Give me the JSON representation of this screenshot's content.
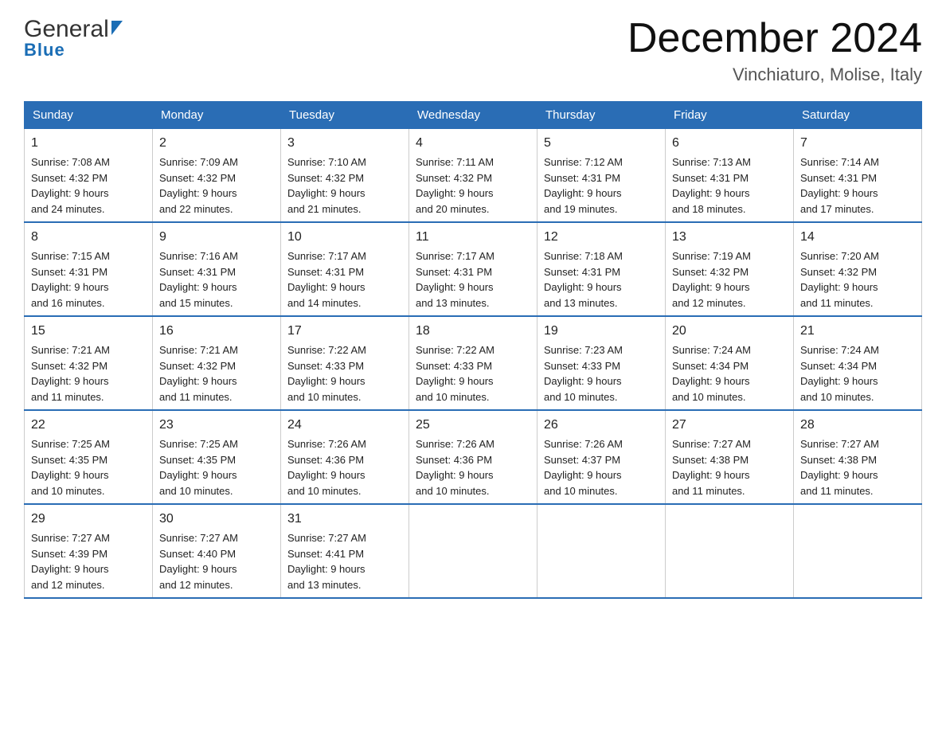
{
  "logo": {
    "general_text": "General",
    "blue_text": "Blue"
  },
  "title": "December 2024",
  "subtitle": "Vinchiaturo, Molise, Italy",
  "weekdays": [
    "Sunday",
    "Monday",
    "Tuesday",
    "Wednesday",
    "Thursday",
    "Friday",
    "Saturday"
  ],
  "weeks": [
    [
      {
        "day": "1",
        "sunrise": "7:08 AM",
        "sunset": "4:32 PM",
        "daylight": "9 hours and 24 minutes."
      },
      {
        "day": "2",
        "sunrise": "7:09 AM",
        "sunset": "4:32 PM",
        "daylight": "9 hours and 22 minutes."
      },
      {
        "day": "3",
        "sunrise": "7:10 AM",
        "sunset": "4:32 PM",
        "daylight": "9 hours and 21 minutes."
      },
      {
        "day": "4",
        "sunrise": "7:11 AM",
        "sunset": "4:32 PM",
        "daylight": "9 hours and 20 minutes."
      },
      {
        "day": "5",
        "sunrise": "7:12 AM",
        "sunset": "4:31 PM",
        "daylight": "9 hours and 19 minutes."
      },
      {
        "day": "6",
        "sunrise": "7:13 AM",
        "sunset": "4:31 PM",
        "daylight": "9 hours and 18 minutes."
      },
      {
        "day": "7",
        "sunrise": "7:14 AM",
        "sunset": "4:31 PM",
        "daylight": "9 hours and 17 minutes."
      }
    ],
    [
      {
        "day": "8",
        "sunrise": "7:15 AM",
        "sunset": "4:31 PM",
        "daylight": "9 hours and 16 minutes."
      },
      {
        "day": "9",
        "sunrise": "7:16 AM",
        "sunset": "4:31 PM",
        "daylight": "9 hours and 15 minutes."
      },
      {
        "day": "10",
        "sunrise": "7:17 AM",
        "sunset": "4:31 PM",
        "daylight": "9 hours and 14 minutes."
      },
      {
        "day": "11",
        "sunrise": "7:17 AM",
        "sunset": "4:31 PM",
        "daylight": "9 hours and 13 minutes."
      },
      {
        "day": "12",
        "sunrise": "7:18 AM",
        "sunset": "4:31 PM",
        "daylight": "9 hours and 13 minutes."
      },
      {
        "day": "13",
        "sunrise": "7:19 AM",
        "sunset": "4:32 PM",
        "daylight": "9 hours and 12 minutes."
      },
      {
        "day": "14",
        "sunrise": "7:20 AM",
        "sunset": "4:32 PM",
        "daylight": "9 hours and 11 minutes."
      }
    ],
    [
      {
        "day": "15",
        "sunrise": "7:21 AM",
        "sunset": "4:32 PM",
        "daylight": "9 hours and 11 minutes."
      },
      {
        "day": "16",
        "sunrise": "7:21 AM",
        "sunset": "4:32 PM",
        "daylight": "9 hours and 11 minutes."
      },
      {
        "day": "17",
        "sunrise": "7:22 AM",
        "sunset": "4:33 PM",
        "daylight": "9 hours and 10 minutes."
      },
      {
        "day": "18",
        "sunrise": "7:22 AM",
        "sunset": "4:33 PM",
        "daylight": "9 hours and 10 minutes."
      },
      {
        "day": "19",
        "sunrise": "7:23 AM",
        "sunset": "4:33 PM",
        "daylight": "9 hours and 10 minutes."
      },
      {
        "day": "20",
        "sunrise": "7:24 AM",
        "sunset": "4:34 PM",
        "daylight": "9 hours and 10 minutes."
      },
      {
        "day": "21",
        "sunrise": "7:24 AM",
        "sunset": "4:34 PM",
        "daylight": "9 hours and 10 minutes."
      }
    ],
    [
      {
        "day": "22",
        "sunrise": "7:25 AM",
        "sunset": "4:35 PM",
        "daylight": "9 hours and 10 minutes."
      },
      {
        "day": "23",
        "sunrise": "7:25 AM",
        "sunset": "4:35 PM",
        "daylight": "9 hours and 10 minutes."
      },
      {
        "day": "24",
        "sunrise": "7:26 AM",
        "sunset": "4:36 PM",
        "daylight": "9 hours and 10 minutes."
      },
      {
        "day": "25",
        "sunrise": "7:26 AM",
        "sunset": "4:36 PM",
        "daylight": "9 hours and 10 minutes."
      },
      {
        "day": "26",
        "sunrise": "7:26 AM",
        "sunset": "4:37 PM",
        "daylight": "9 hours and 10 minutes."
      },
      {
        "day": "27",
        "sunrise": "7:27 AM",
        "sunset": "4:38 PM",
        "daylight": "9 hours and 11 minutes."
      },
      {
        "day": "28",
        "sunrise": "7:27 AM",
        "sunset": "4:38 PM",
        "daylight": "9 hours and 11 minutes."
      }
    ],
    [
      {
        "day": "29",
        "sunrise": "7:27 AM",
        "sunset": "4:39 PM",
        "daylight": "9 hours and 12 minutes."
      },
      {
        "day": "30",
        "sunrise": "7:27 AM",
        "sunset": "4:40 PM",
        "daylight": "9 hours and 12 minutes."
      },
      {
        "day": "31",
        "sunrise": "7:27 AM",
        "sunset": "4:41 PM",
        "daylight": "9 hours and 13 minutes."
      },
      null,
      null,
      null,
      null
    ]
  ]
}
